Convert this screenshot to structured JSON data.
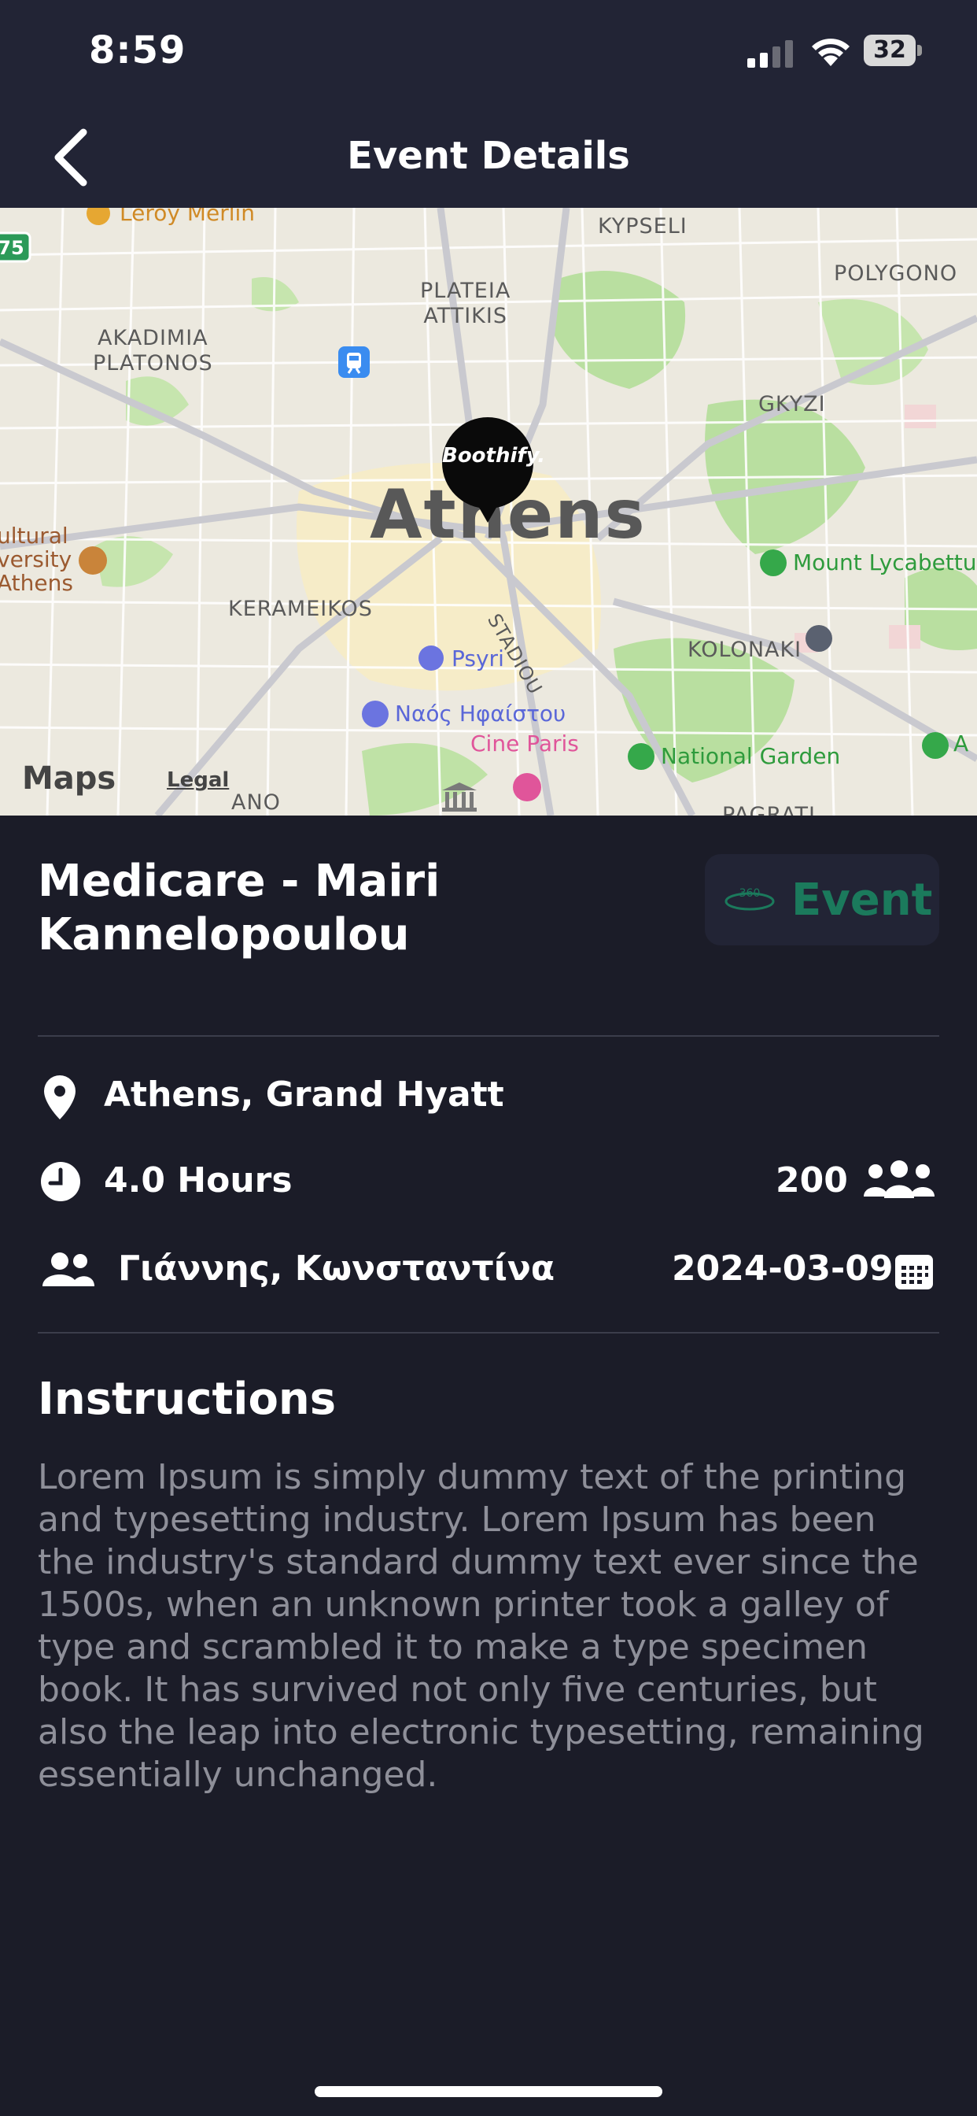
{
  "status_bar": {
    "time": "8:59",
    "battery": "32"
  },
  "header": {
    "title": "Event Details"
  },
  "map": {
    "city_label": "Athens",
    "labels": {
      "kypseli": "KYPSELI",
      "plateia_attikis": "PLATEIA\nATTIKIS",
      "polygono": "POLYGONO",
      "akadimia_platonos": "AKADIMIA\nPLATONOS",
      "gkyzi": "GKYZI",
      "leroy_merlin": "Leroy Merlin",
      "cultural_university": "ultural\nversity\nAthens",
      "mount_lycabettus": "Mount Lycabettu",
      "keramikos": "KERAMEIKOS",
      "stadiou": "STADIOU",
      "psyri": "Psyri",
      "kolonaki": "KOLONAKI",
      "naos": "Ναός Ηφαίστου",
      "cine_paris": "Cine Paris",
      "national_garden": "National Garden",
      "a_label": "A",
      "ano": "ANO",
      "pagrati": "PAGRATI",
      "road_number": "75"
    },
    "pin_brand": "Boothify.",
    "attribution": "Maps",
    "legal": "Legal"
  },
  "event": {
    "title": "Medicare - Mairi Kannelopoulou",
    "badge_icon": "360",
    "badge_label": "Event",
    "location": "Athens, Grand Hyatt",
    "duration": "4.0 Hours",
    "guests": "200",
    "staff": "Γιάννης, Κωνσταντίνα",
    "date": "2024-03-09"
  },
  "instructions": {
    "title": "Instructions",
    "text": "Lorem Ipsum is simply dummy text of the printing and typesetting industry. Lorem Ipsum has been the industry's standard dummy text ever since the 1500s, when an unknown printer took a galley of type and scrambled it to make a type specimen book. It has survived not only five centuries, but also the leap into electronic typesetting, remaining essentially unchanged."
  },
  "colors": {
    "background": "#1b1c28",
    "header": "#222435",
    "badge_text": "#1b7a5c",
    "body_text": "#8e8f99"
  }
}
